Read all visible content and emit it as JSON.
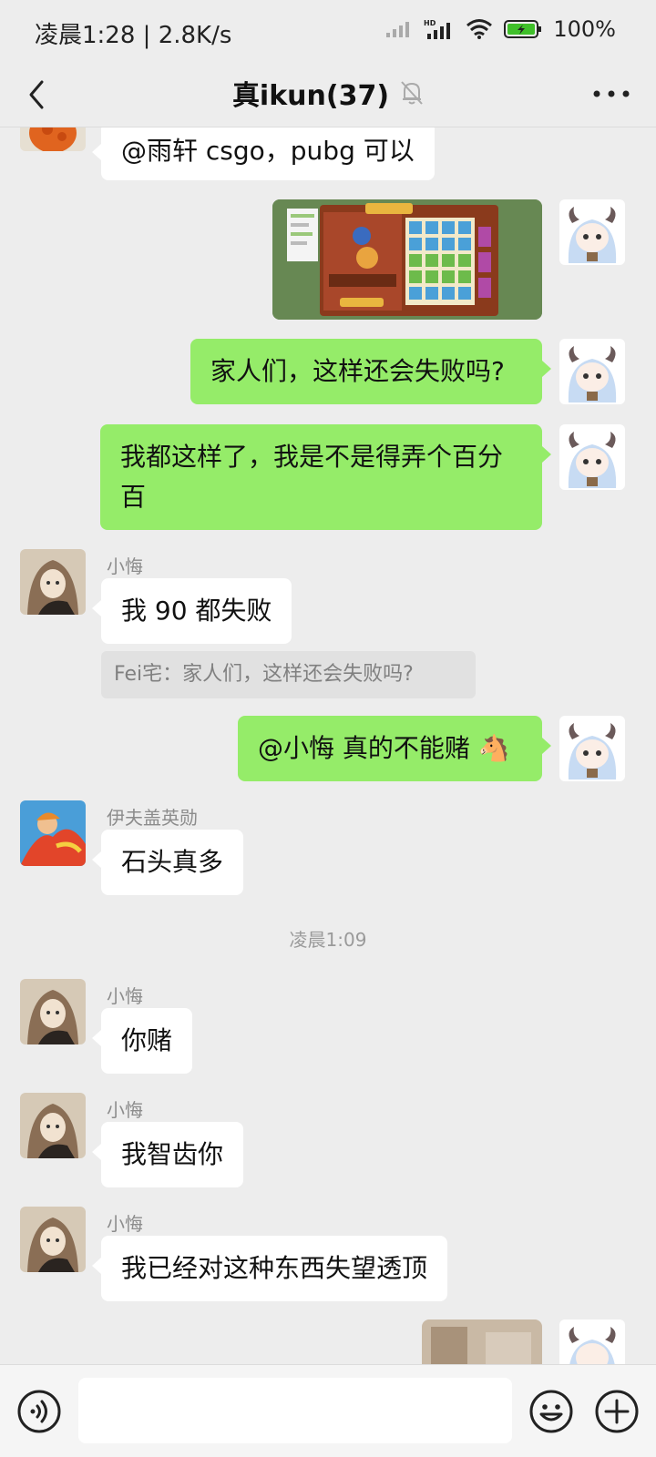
{
  "status": {
    "time": "凌晨1:28",
    "speed": "2.8K/s",
    "separator": "|",
    "battery": "100%"
  },
  "header": {
    "title": "真ikun(37)"
  },
  "messages": {
    "m1": "@雨轩  csgo，pubg 可以",
    "m3": "家人们，这样还会失败吗?",
    "m4_line1": "我都这样了，我是不是得弄个百分",
    "m4_line2": "百",
    "m5_sender": "小悔",
    "m5": "我 90 都失败",
    "m5_quote": "Fei宅：家人们，这样还会失败吗?",
    "m6": "@小悔  真的不能赌 🐴",
    "m7_sender": "伊夫盖英勋",
    "m7": "石头真多",
    "timestamp": "凌晨1:09",
    "m8_sender": "小悔",
    "m8": "你赌",
    "m9_sender": "小悔",
    "m9": "我智齿你",
    "m10_sender": "小悔",
    "m10": "我已经对这种东西失望透顶"
  },
  "input": {
    "placeholder": ""
  },
  "icons": {
    "back": "chevron-left-icon",
    "mute": "bell-off-icon",
    "more": "more-dots-icon",
    "voice": "voice-icon",
    "emoji": "emoji-icon",
    "add": "plus-icon"
  }
}
